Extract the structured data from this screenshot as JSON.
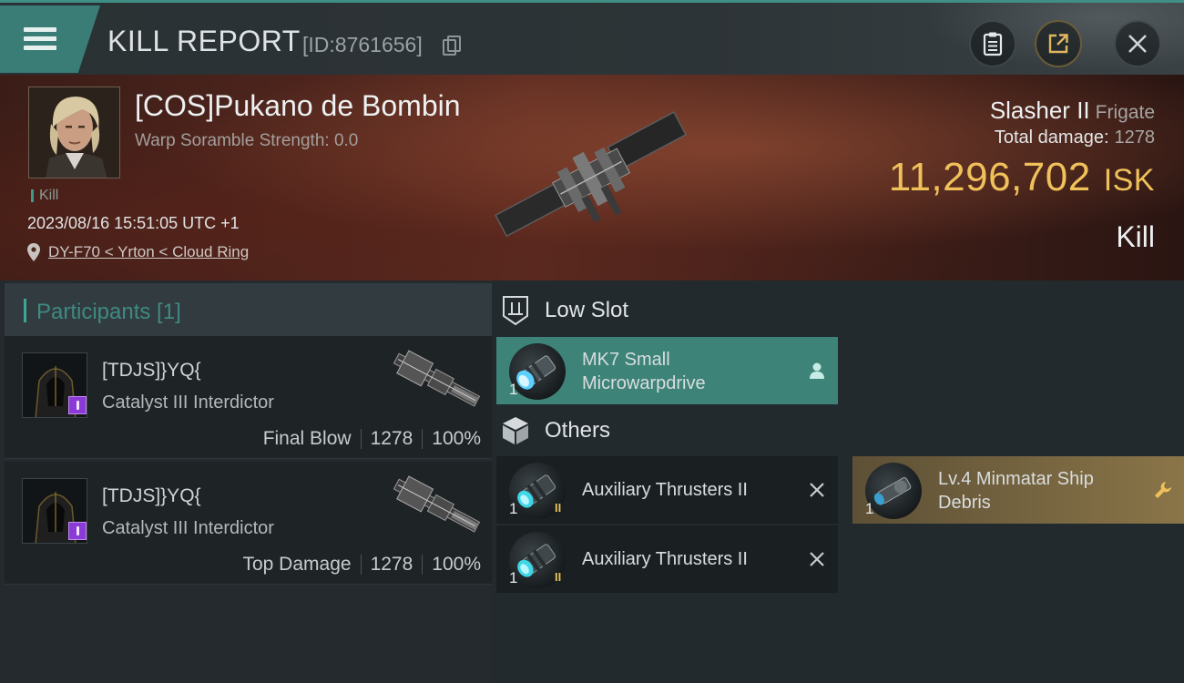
{
  "header": {
    "title": "KILL REPORT",
    "report_id": "[ID:8761656]",
    "buttons": [
      "clipboard-icon",
      "share-icon",
      "close-icon"
    ]
  },
  "victim": {
    "name": "[COS]Pukano de Bombin",
    "warp_scramble": "Warp Soramble Strength: 0.0",
    "tag": "Kill",
    "datetime": "2023/08/16 15:51:05 UTC +1",
    "location": "DY-F70 < Yrton < Cloud Ring",
    "ship": "Slasher II",
    "ship_class": "Frigate",
    "total_damage_label": "Total damage:",
    "total_damage": "1278",
    "isk_value": "11,296,702",
    "isk_unit": "ISK",
    "result": "Kill"
  },
  "participants": {
    "header": "Participants [1]",
    "items": [
      {
        "name": "[TDJS]}YQ{",
        "ship": "Catalyst III Interdictor",
        "role": "Final Blow",
        "damage": "1278",
        "percent": "100%"
      },
      {
        "name": "[TDJS]}YQ{",
        "ship": "Catalyst III Interdictor",
        "role": "Top Damage",
        "damage": "1278",
        "percent": "100%"
      }
    ]
  },
  "fittings": {
    "low_slot": {
      "title": "Low Slot",
      "items": [
        {
          "qty": "1",
          "name": "MK7 Small Microwarpdrive",
          "action_icon": "person-icon"
        }
      ]
    },
    "others": {
      "title": "Others",
      "items": [
        {
          "qty": "1",
          "meta": "II",
          "name": "Auxiliary Thrusters II",
          "action_icon": "x-icon"
        },
        {
          "qty": "1",
          "meta": "II",
          "name": "Auxiliary Thrusters II",
          "action_icon": "x-icon"
        },
        {
          "qty": "1",
          "name": "Lv.4 Minmatar Ship Debris",
          "action_icon": "wrench-icon"
        }
      ]
    }
  },
  "colors": {
    "accent": "#3d8378",
    "isk": "#f0c15a",
    "debris": "#8a7548",
    "banner": "#5a2a20"
  }
}
